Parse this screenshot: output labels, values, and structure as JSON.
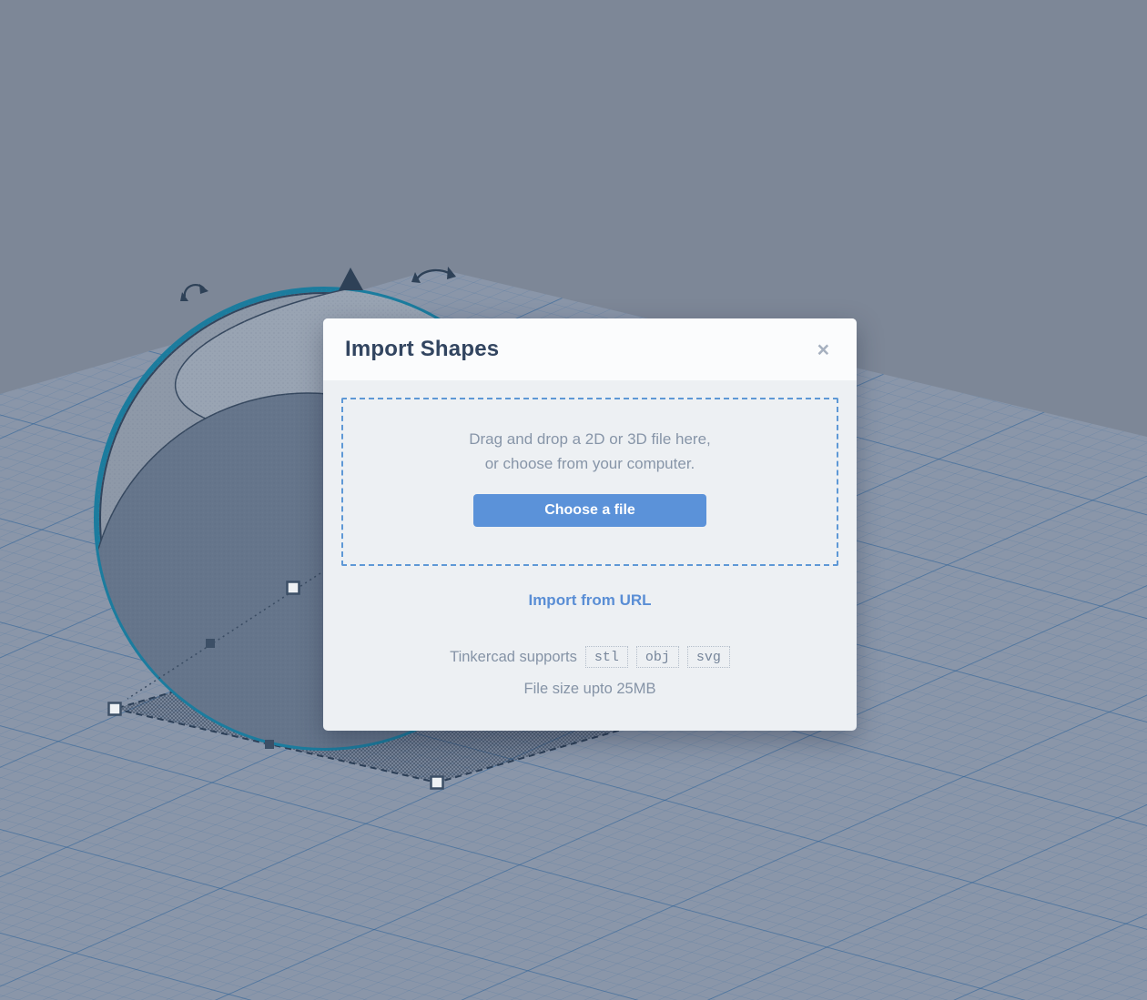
{
  "modal": {
    "title": "Import Shapes",
    "close_label": "×",
    "dropzone": {
      "line1": "Drag and drop a 2D or 3D file here,",
      "line2": "or choose from your computer.",
      "button_label": "Choose a file"
    },
    "import_url_label": "Import from URL",
    "supports": {
      "prefix": "Tinkercad supports",
      "formats": [
        "stl",
        "obj",
        "svg"
      ]
    },
    "size_note": "File size upto 25MB"
  },
  "scene": {
    "selected_shape": "sphere",
    "handle_types": [
      "corner-scale-handle",
      "edge-scale-handle",
      "move-up-cone",
      "rotate-arrow"
    ]
  },
  "colors": {
    "accent_blue": "#5b92d9",
    "link_blue": "#5a8ed5",
    "dropzone_border": "#5e98d6",
    "selection_teal": "#1b7c9e",
    "sky": "#7d8797",
    "workplane": "#8a96a9",
    "grid_line": "#4f7ca8",
    "modal_header_bg": "#fbfcfd",
    "modal_body_bg": "#edf0f3",
    "title_text": "#324560",
    "muted_text": "#8795a8"
  }
}
